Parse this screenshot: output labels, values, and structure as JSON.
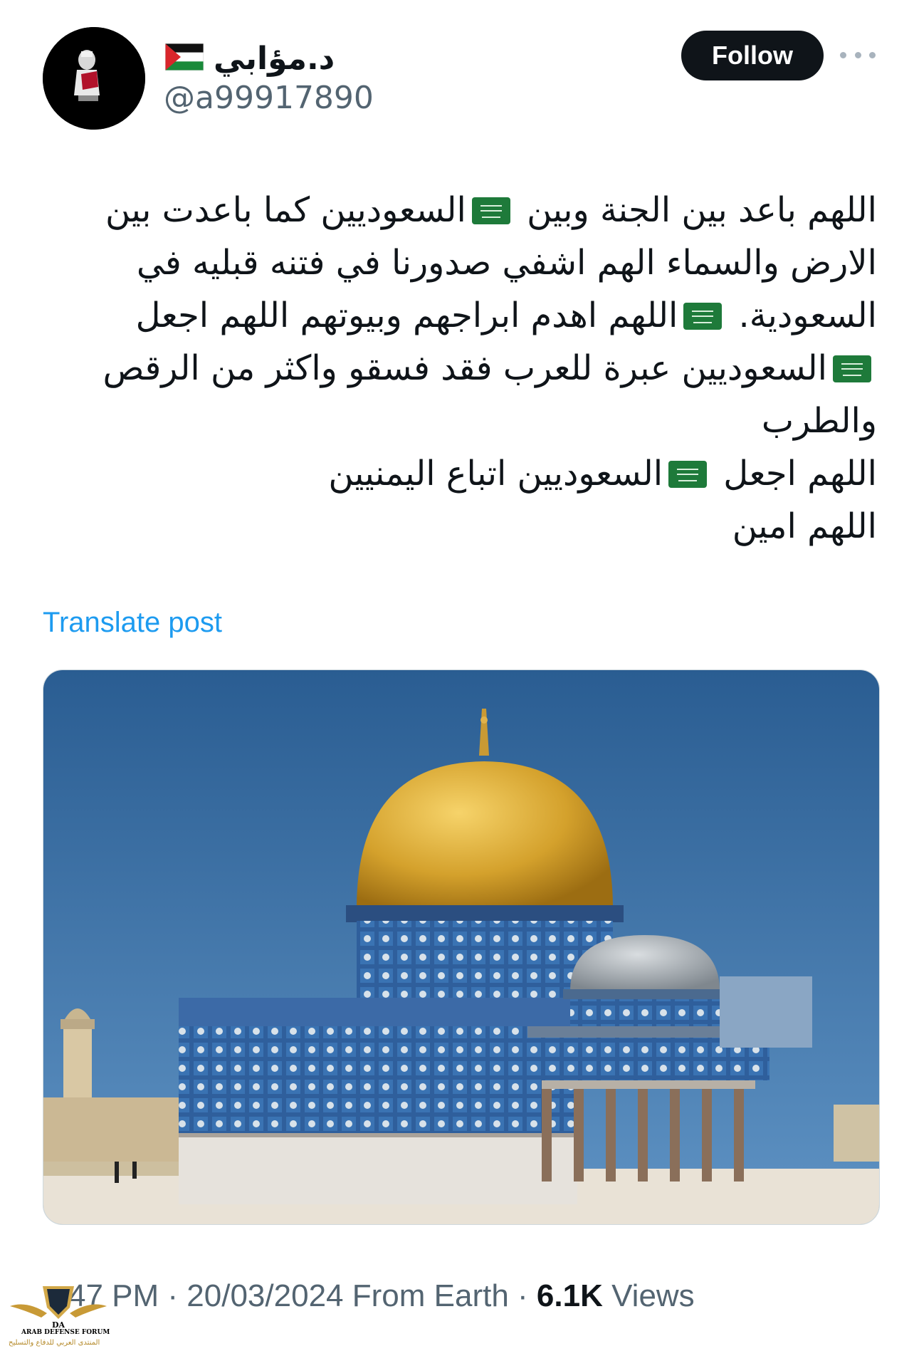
{
  "author": {
    "display_name": "د.مؤابي",
    "handle": "@a99917890",
    "avatar_icon": "profile-avatar",
    "name_emoji_icon": "palestine-flag-icon"
  },
  "follow_label": "Follow",
  "more_icon": "more-options-icon",
  "post": {
    "lines": [
      "اللهم باعد بين الجنة وبين {flag}السعوديين كما باعدت بين",
      "الارض والسماء  الهم اشفي صدورنا في فتنه قبليه في",
      "السعودية. {flag}اللهم اهدم ابراجهم وبيوتهم اللهم اجعل",
      "{flag}السعوديين عبرة للعرب فقد فسقو واكثر من الرقص",
      "والطرب",
      "اللهم اجعل {flag}السعوديين اتباع اليمنيين",
      "اللهم امين"
    ],
    "flag_icon": "saudi-flag-icon"
  },
  "translate_label": "Translate post",
  "media": {
    "subject_icon": "dome-of-the-rock-photo"
  },
  "meta": {
    "time": "47 PM",
    "separator": "·",
    "date": "20/03/2024",
    "source": "From Earth",
    "views_count": "6.1K",
    "views_label": "Views"
  },
  "watermark": {
    "initials": "DA",
    "title": "ARAB DEFENSE FORUM",
    "subtitle": "المنتدى العربي للدفاع والتسليح"
  },
  "colors": {
    "accent_link": "#1d9bf0",
    "text_primary": "#0f1419",
    "text_secondary": "#536471",
    "follow_bg": "#0f1419",
    "flag_green": "#1e7a3a"
  }
}
